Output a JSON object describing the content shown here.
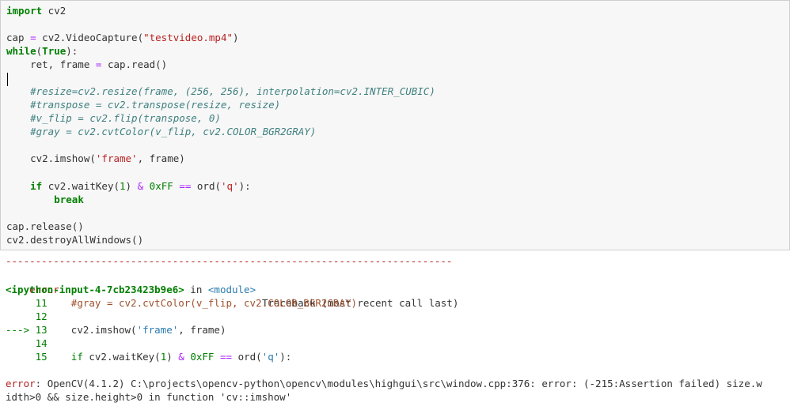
{
  "code": {
    "l1": [
      "import",
      " cv2"
    ],
    "l2": [
      "cap ",
      "=",
      " cv2.VideoCapture(",
      "\"testvideo.mp4\"",
      ")"
    ],
    "l3": [
      "while",
      "(",
      "True",
      "):"
    ],
    "l4": [
      "    ret, frame ",
      "=",
      " cap.read()"
    ],
    "l5": "    #resize=cv2.resize(frame, (256, 256), interpolation=cv2.INTER_CUBIC)",
    "l6": "    #transpose = cv2.transpose(resize, resize)",
    "l7": "    #v_flip = cv2.flip(transpose, 0)",
    "l8": "    #gray = cv2.cvtColor(v_flip, cv2.COLOR_BGR2GRAY)",
    "l9": [
      "    cv2.imshow(",
      "'frame'",
      ", frame)"
    ],
    "l10": [
      "    ",
      "if",
      " cv2.waitKey(",
      "1",
      ") ",
      "&",
      " ",
      "0xFF",
      " ",
      "==",
      " ord(",
      "'q'",
      "):"
    ],
    "l11": [
      "        ",
      "break"
    ],
    "l12": "cap.release()",
    "l13": "cv2.destroyAllWindows()"
  },
  "output": {
    "dashes": "---------------------------------------------------------------------------",
    "error_name": "error",
    "traceback_head": "Traceback (most recent call last)",
    "input_ref": "<ipython-input-4-7cb23423b9e6>",
    "in_word": " in ",
    "module": "<module>",
    "tb": [
      {
        "num": "     11",
        "code": "    #gray = cv2.cvtColor(v_flip, cv2.COLOR_BGR2GRAY)"
      },
      {
        "num": "     12",
        "code": ""
      },
      {
        "arrow": "---> 13",
        "code_a": "    cv2.imshow(",
        "code_str": "'frame'",
        "code_b": ", frame)"
      },
      {
        "num": "     14",
        "code": ""
      },
      {
        "num": "     15",
        "code": ""
      }
    ],
    "tb15": [
      "    ",
      "if",
      " cv2.waitKey(",
      "1",
      ") ",
      "&",
      " ",
      "0xFF",
      " ",
      "==",
      " ord(",
      "'q'",
      "):"
    ],
    "err_label": "error",
    "err_msg1": ": OpenCV(4.1.2) C:\\projects\\opencv-python\\opencv\\modules\\highgui\\src\\window.cpp:376: error: (-215:Assertion failed) size.w",
    "err_msg2": "idth>0 && size.height>0 in function 'cv::imshow'"
  }
}
